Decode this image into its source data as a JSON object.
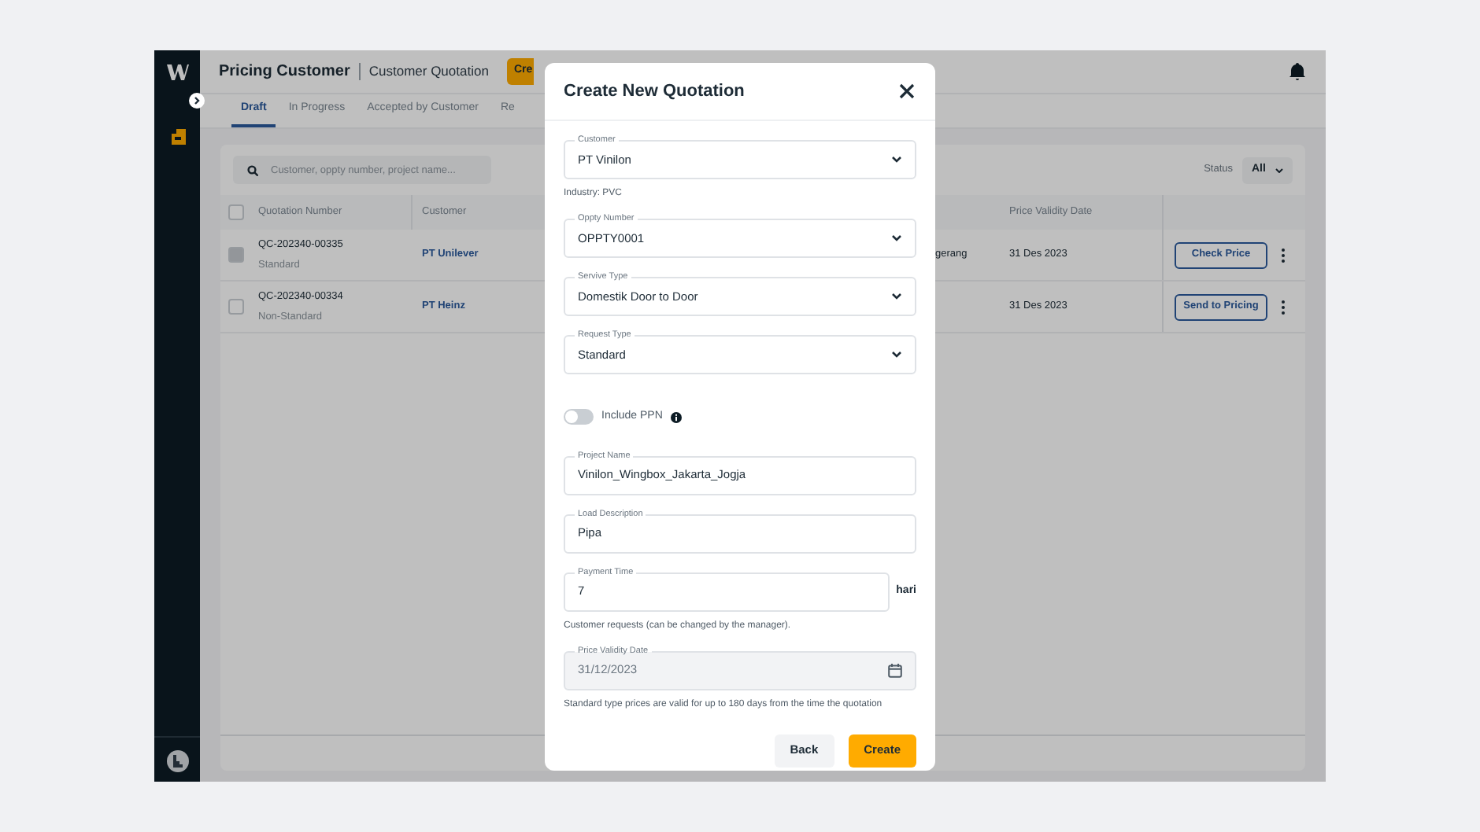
{
  "header": {
    "title": "Pricing Customer",
    "subtitle": "Customer Quotation",
    "create_button": "Cre"
  },
  "tabs": [
    {
      "label": "Draft",
      "selected": true
    },
    {
      "label": "In Progress",
      "selected": false
    },
    {
      "label": "Accepted by Customer",
      "selected": false
    },
    {
      "label": "Re",
      "selected": false
    }
  ],
  "filters": {
    "search_placeholder": "Customer, oppty number, project name...",
    "status_label": "Status",
    "status_value": "All"
  },
  "table": {
    "select_all_checked": false,
    "columns": [
      "Quotation Number",
      "Customer",
      "Price Validity Date"
    ],
    "rows": [
      {
        "disabled": true,
        "quotation_number": "QC-202340-00335",
        "type": "Standard",
        "customer": "PT Unilever",
        "column_4": "gerang",
        "price_validity_date": "31 Des 2023",
        "action": "Check Price"
      },
      {
        "disabled": false,
        "quotation_number": "QC-202340-00334",
        "type": "Non-Standard",
        "customer": "PT Heinz",
        "price_validity_date": "31 Des 2023",
        "action": "Send to Pricing"
      }
    ]
  },
  "modal": {
    "title": "Create New Quotation",
    "fields": [
      {
        "kind": "select",
        "label": "Customer",
        "value": "PT Vinilon",
        "hint": "Industry: PVC"
      },
      {
        "kind": "select",
        "label": "Oppty Number",
        "value": "OPPTY0001"
      },
      {
        "kind": "select",
        "label": "Servive Type",
        "value": "Domestik Door to Door"
      },
      {
        "kind": "select",
        "label": "Request Type",
        "value": "Standard"
      },
      {
        "kind": "toggle",
        "label": "Include PPN",
        "on": false
      },
      {
        "kind": "text",
        "label": "Project Name",
        "value": "Vinilon_Wingbox_Jakarta_Jogja"
      },
      {
        "kind": "text",
        "label": "Load Description",
        "value": "Pipa"
      },
      {
        "kind": "text",
        "label": "Payment Time",
        "value": "7",
        "suffix": "hari",
        "hint": "Customer requests (can be changed by the manager)."
      },
      {
        "kind": "date",
        "label": "Price Validity Date",
        "value": "31/12/2023",
        "disabled": true,
        "hint": "Standard type prices are valid for up to 180 days from the time the quotation"
      }
    ],
    "buttons": [
      {
        "label": "Back",
        "kind": "secondary"
      },
      {
        "label": "Create",
        "kind": "primary"
      }
    ]
  }
}
